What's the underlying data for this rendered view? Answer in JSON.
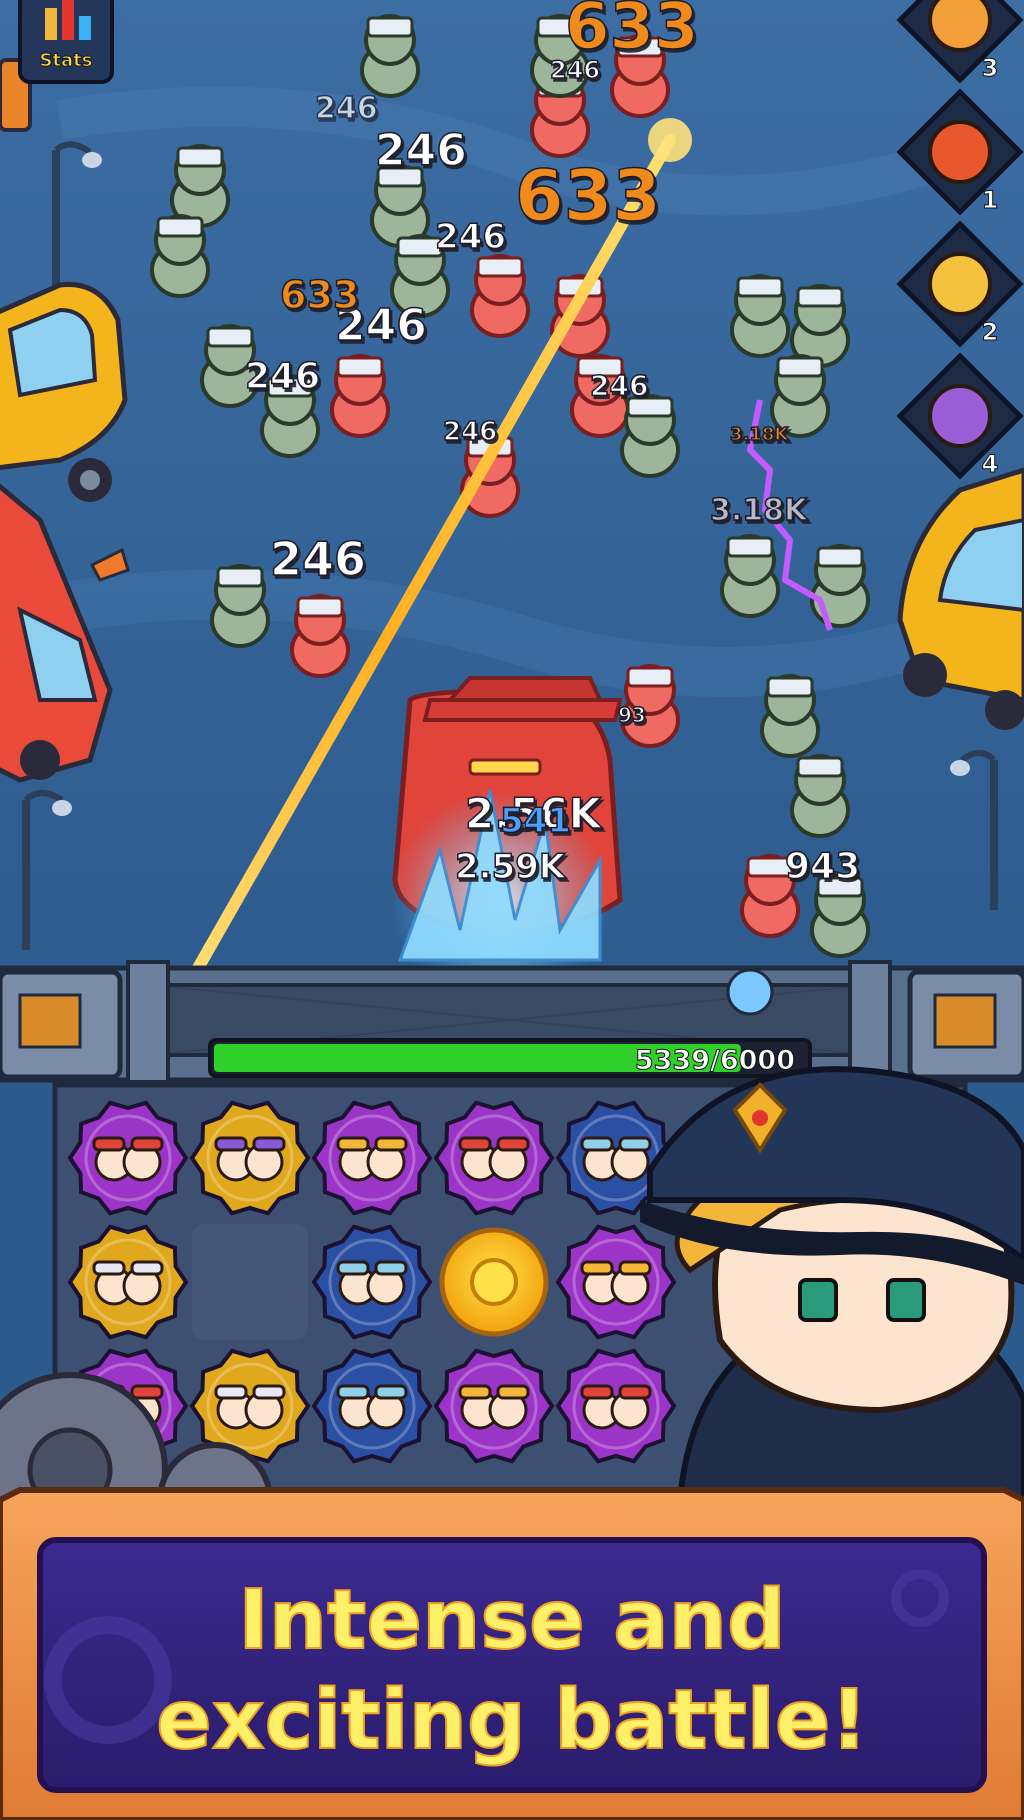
{
  "hud": {
    "stats_label": "Stats"
  },
  "hero_slots": [
    {
      "count": "3",
      "color": "#f2a13a"
    },
    {
      "count": "1",
      "color": "#e8572e"
    },
    {
      "count": "2",
      "color": "#f4c23d"
    },
    {
      "count": "4",
      "color": "#9a5ed8"
    }
  ],
  "damage_numbers": [
    {
      "text": "633",
      "color": "#f08a1e"
    },
    {
      "text": "246",
      "color": "#ffffff"
    },
    {
      "text": "246",
      "color": "#ffffff"
    },
    {
      "text": "246",
      "color": "#ffffff"
    },
    {
      "text": "246",
      "color": "#ffffff"
    },
    {
      "text": "246",
      "color": "#ffffff"
    },
    {
      "text": "246",
      "color": "#ffffff"
    },
    {
      "text": "246",
      "color": "#ffffff"
    },
    {
      "text": "633",
      "color": "#f08a1e"
    },
    {
      "text": "633",
      "color": "#f08a1e"
    },
    {
      "text": "246",
      "color": "#ffffff"
    },
    {
      "text": "246",
      "color": "#ffffff"
    },
    {
      "text": "3.18K",
      "color": "#b9b9c9"
    },
    {
      "text": "3.18K",
      "color": "#f08a1e"
    },
    {
      "text": "2.56K",
      "color": "#ffffff"
    },
    {
      "text": "541",
      "color": "#4aa0ff"
    },
    {
      "text": "2.59K",
      "color": "#ffffff"
    },
    {
      "text": "943",
      "color": "#ffffff"
    },
    {
      "text": "93",
      "color": "#ffffff"
    }
  ],
  "wall": {
    "hp_text": "5339/6000",
    "hp_fraction": 0.8898,
    "hp_color": "#2fd12a"
  },
  "grid_tiles": [
    {
      "frame": "#9b35c7",
      "unit": "red-hat-gunner"
    },
    {
      "frame": "#e0a81c",
      "unit": "purple-mage"
    },
    {
      "frame": "#9b35c7",
      "unit": "goggle-engineer"
    },
    {
      "frame": "#9b35c7",
      "unit": "red-hat-gunner"
    },
    {
      "frame": "#2b4fa3",
      "unit": "robot-turret"
    },
    {
      "frame": "#e0a81c",
      "unit": "white-hair-mage"
    },
    {
      "frame": "empty",
      "unit": ""
    },
    {
      "frame": "#2b4fa3",
      "unit": "robot-turret"
    },
    {
      "frame": "coin",
      "unit": "gold-coin"
    },
    {
      "frame": "#9b35c7",
      "unit": "goggle-engineer"
    },
    {
      "frame": "#9b35c7",
      "unit": "red-hat-gunner"
    },
    {
      "frame": "#e0a81c",
      "unit": "white-hair-mage"
    },
    {
      "frame": "#2b4fa3",
      "unit": "robot-turret"
    },
    {
      "frame": "#9b35c7",
      "unit": "goggle-engineer"
    },
    {
      "frame": "#9b35c7",
      "unit": "red-hat-gunner"
    }
  ],
  "banner": {
    "line1": "Intense and",
    "line2": "exciting battle!"
  }
}
